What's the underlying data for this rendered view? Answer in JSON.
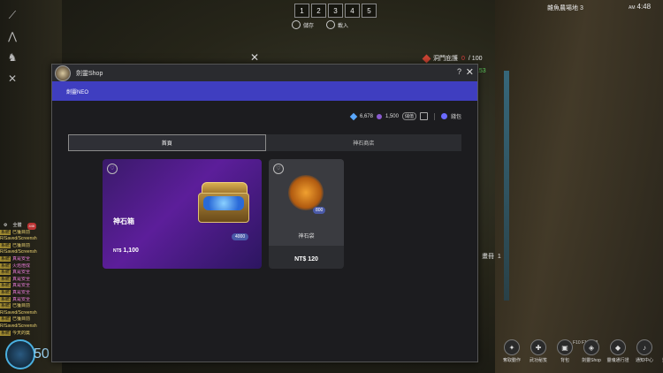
{
  "hud": {
    "hotbar": [
      "1",
      "2",
      "3",
      "4",
      "5"
    ],
    "save_label": "儲存",
    "load_label": "載入",
    "location": "雜魚農場地 3",
    "clock_ampm": "AM",
    "clock_time": "4:48",
    "quest_label": "洞門庇護",
    "quest_current": "0",
    "quest_total": "/ 100",
    "green_value": "153",
    "ctr_label": "畫冊",
    "ctr_value": "1",
    "skill_level": "50"
  },
  "chat": {
    "tab_all": "全體",
    "tab_badge": "446",
    "lines": [
      {
        "tag": "系統",
        "text": "已獲目前"
      },
      {
        "tag": "",
        "text": "R/Saved/Screensh"
      },
      {
        "tag": "系統",
        "text": "已獲目前"
      },
      {
        "tag": "",
        "text": "R/Saved/Screensh"
      },
      {
        "tag": "系統",
        "text": "真是安全"
      },
      {
        "tag": "系統",
        "text": "火焰燈成"
      },
      {
        "tag": "系統",
        "text": "真是安全"
      },
      {
        "tag": "系統",
        "text": "真是安全"
      },
      {
        "tag": "系統",
        "text": "真是安全"
      },
      {
        "tag": "系統",
        "text": "真是安全"
      },
      {
        "tag": "系統",
        "text": "真是安全"
      },
      {
        "tag": "系統",
        "text": "已獲目前"
      },
      {
        "tag": "",
        "text": "R/Saved/Screensh"
      },
      {
        "tag": "系統",
        "text": "已獲目前"
      },
      {
        "tag": "",
        "text": "R/Saved/Screensh"
      },
      {
        "tag": "系統",
        "text": "今天的獎"
      }
    ]
  },
  "bottom_menu": {
    "fkeys": "F10     F11     F12",
    "items": [
      {
        "label": "奪取動作",
        "icon": "✦"
      },
      {
        "label": "武功秘笈",
        "icon": "✚"
      },
      {
        "label": "背包",
        "icon": "▣"
      },
      {
        "label": "劍靈Shop",
        "icon": "◈"
      },
      {
        "label": "靈魂通行證",
        "icon": "◆"
      },
      {
        "label": "通知中心",
        "icon": "♪"
      },
      {
        "label": "遊戲選單",
        "icon": "≡"
      }
    ]
  },
  "shop": {
    "title": "劍靈Shop",
    "help": "?",
    "close": "✕",
    "banner": "劍靈NEO",
    "currency": {
      "gems": "6,678",
      "coins": "1,500",
      "coin_tag": "儲值",
      "wallet": "錢包"
    },
    "tabs": [
      "首頁",
      "神石商店"
    ],
    "products": [
      {
        "name": "神石箱",
        "currency": "NT$",
        "price": "1,100",
        "badge": "4000"
      },
      {
        "name": "神石袋",
        "price": "NT$ 120",
        "badge": "800"
      }
    ]
  }
}
